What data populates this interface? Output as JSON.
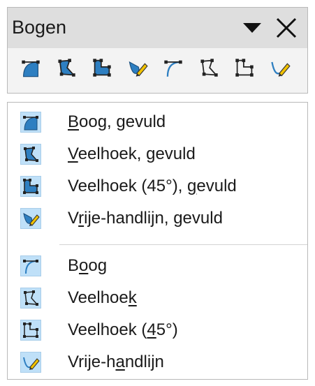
{
  "toolbar": {
    "title": "Bogen",
    "dropdown_icon": "triangle-down-icon",
    "close_icon": "close-icon",
    "buttons": [
      {
        "icon": "arc-filled-icon"
      },
      {
        "icon": "polygon-filled-icon"
      },
      {
        "icon": "polygon-45-filled-icon"
      },
      {
        "icon": "freeform-line-filled-icon"
      },
      {
        "icon": "arc-icon"
      },
      {
        "icon": "polygon-icon"
      },
      {
        "icon": "polygon-45-icon"
      },
      {
        "icon": "freeform-line-icon"
      }
    ]
  },
  "menu": {
    "items": [
      {
        "icon": "arc-filled-icon",
        "pre": "",
        "key": "B",
        "post": "oog, gevuld"
      },
      {
        "icon": "polygon-filled-icon",
        "pre": "",
        "key": "V",
        "post": "eelhoek, gevuld"
      },
      {
        "icon": "polygon-45-filled-icon",
        "pre": "Veelhoek (45°), ",
        "key": "g",
        "post": "evuld"
      },
      {
        "icon": "freeform-line-filled-icon",
        "pre": "V",
        "key": "r",
        "post": "ije-handlijn, gevuld"
      },
      {
        "icon": "arc-icon",
        "pre": "B",
        "key": "o",
        "post": "og"
      },
      {
        "icon": "polygon-icon",
        "pre": "Veelhoe",
        "key": "k",
        "post": ""
      },
      {
        "icon": "polygon-45-icon",
        "pre": "Veelhoek (",
        "key": "4",
        "post": "5°)"
      },
      {
        "icon": "freeform-line-icon",
        "pre": "Vrije-h",
        "key": "a",
        "post": "ndlijn"
      }
    ]
  },
  "colors": {
    "titlebar_bg": "#dedede",
    "highlight_bg": "#bfe0f8",
    "icon_blue": "#1f6fb5",
    "icon_dark": "#2b2b2b",
    "pencil_yellow": "#f2c200"
  }
}
